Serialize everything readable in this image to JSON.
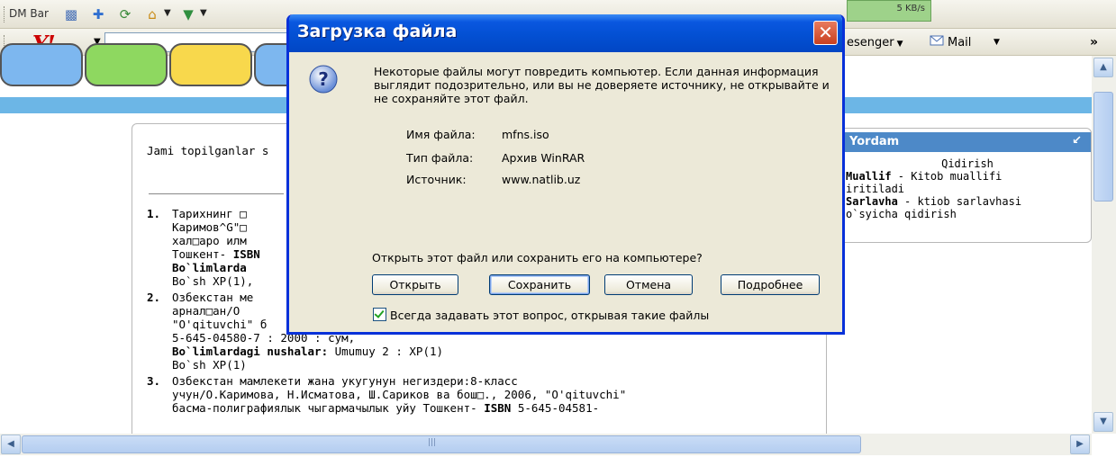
{
  "toolbar1": {
    "dm_bar_label": "DM Bar",
    "speed_text": "5 KB/s"
  },
  "toolbar2": {
    "messenger_label": "esenger",
    "mail_label": "Mail",
    "overflow": "»"
  },
  "page": {
    "found_label": "Jami topilganlar s",
    "results": [
      {
        "num": "1.",
        "lines": [
          "Тарихнинг □",
          "Каримов^G\"□",
          "хал□аро илм",
          "Тошкент- "
        ],
        "isbn": "ISBN",
        "holdings_label": "Bo`limlarda",
        "holdings_line": "Bo`sh XP(1),"
      },
      {
        "num": "2.",
        "lines": [
          "Озбекстан ме",
          "арнал□ан/О",
          "\"O'qituvchi\" б",
          "5-645-04580-7 : 2000 : сўм,"
        ],
        "holdings_label": "Bo`limlardagi nushalar:",
        "holdings_value": " Umumuy 2 : XP(1)",
        "holdings_line": "Bo`sh XP(1)"
      },
      {
        "num": "3.",
        "lines": [
          "Озбекстан мамлекети жана укугунун негиздери:8-класс",
          "учун/О.Каримова, Н.Исматова, Ш.Сариков ва бош□., 2006, \"O'qituvchi\"",
          "басма-полиграфиялык чыгармачылык уйу Тошкент- "
        ],
        "isbn": "ISBN",
        "isbn_tail": " 5-645-04581-"
      }
    ],
    "help": {
      "title": "Yordam",
      "line1": "Qidirish",
      "line2_bold": "Muallif",
      "line2": " - Kitob muallifi",
      "line3": "iritiladi",
      "line4_bold": "Sarlavha",
      "line4": " - ktiob sarlavhasi",
      "line5": "o`syicha qidirish"
    }
  },
  "dialog": {
    "title": "Загрузка файла",
    "close_glyph": "✕",
    "warning": "Некоторые файлы могут повредить компьютер. Если данная информация выглядит подозрительно, или вы не доверяете источнику, не открывайте и не сохраняйте этот файл.",
    "filename_label": "Имя файла:",
    "filename": "mfns.iso",
    "filetype_label": "Тип файла:",
    "filetype": "Архив WinRAR",
    "source_label": "Источник:",
    "source": "www.natlib.uz",
    "prompt": "Открыть этот файл или сохранить его на компьютере?",
    "buttons": {
      "open": "Открыть",
      "save": "Сохранить",
      "cancel": "Отмена",
      "more": "Подробнее"
    },
    "always_ask": "Всегда задавать этот вопрос, открывая такие файлы",
    "always_ask_checked": true
  },
  "colors": {
    "title_blue": "#0a57e0",
    "dialog_bg": "#ece9d8",
    "help_header": "#4d89c8",
    "band": "#6cb6e6"
  }
}
